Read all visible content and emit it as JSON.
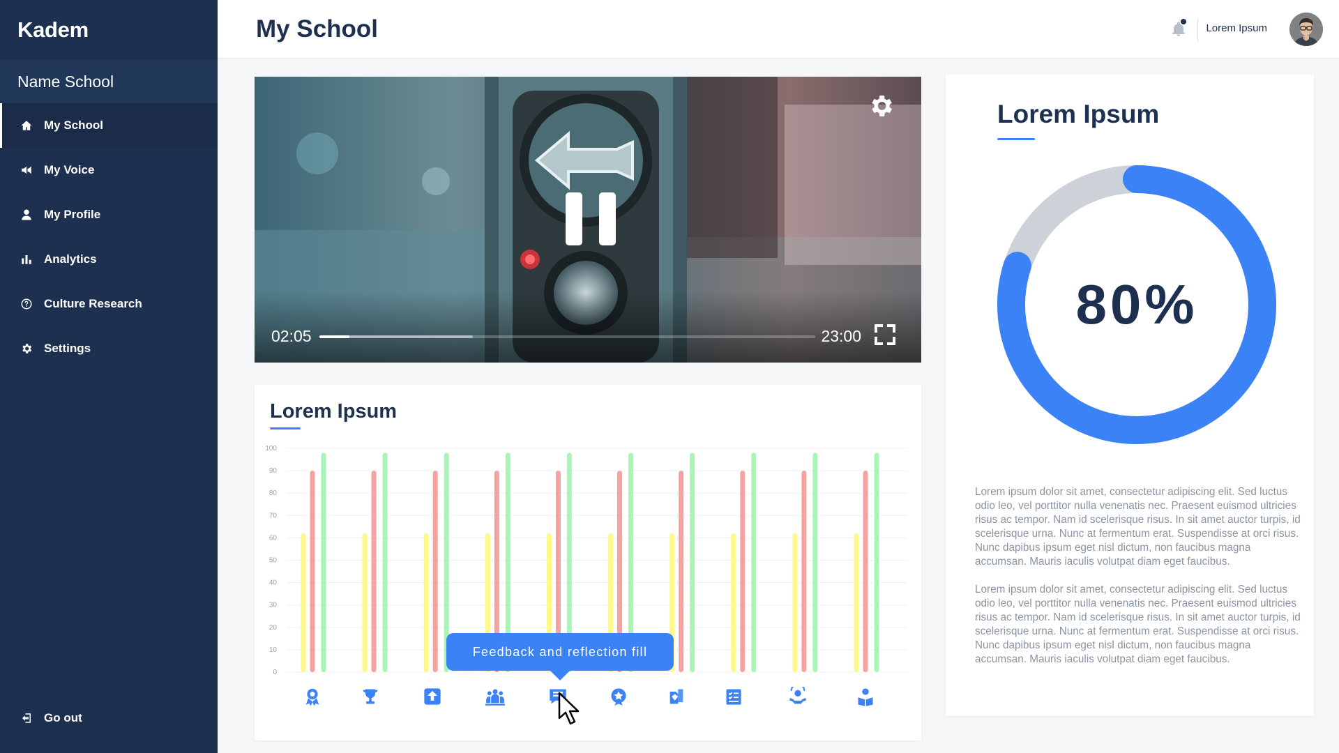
{
  "app": {
    "brand": "Kadem",
    "school_name": "Name School"
  },
  "sidebar": {
    "items": [
      {
        "label": "My School",
        "icon": "home-icon",
        "active": true
      },
      {
        "label": "My Voice",
        "icon": "megaphone-icon",
        "active": false
      },
      {
        "label": "My Profile",
        "icon": "user-icon",
        "active": false
      },
      {
        "label": "Analytics",
        "icon": "bar-chart-icon",
        "active": false
      },
      {
        "label": "Culture Research",
        "icon": "help-circle-icon",
        "active": false
      },
      {
        "label": "Settings",
        "icon": "gear-icon",
        "active": false
      }
    ],
    "logout_label": "Go out"
  },
  "header": {
    "title": "My School",
    "user_name": "Lorem Ipsum",
    "notification_unread": true
  },
  "video": {
    "current_time": "02:05",
    "total_time": "23:00",
    "progress_fraction": 0.06,
    "buffered_fraction": 0.31,
    "state": "playing"
  },
  "chart_card": {
    "title": "Lorem Ipsum",
    "tooltip": "Feedback and reflection fill",
    "hovered_category": 4
  },
  "chart_data": {
    "type": "bar",
    "title": "Lorem Ipsum",
    "categories": [
      "medal-icon",
      "trophy-icon",
      "upload-icon",
      "team-icon",
      "feedback-icon",
      "star-badge-icon",
      "handshake-icon",
      "checklist-icon",
      "support-icon",
      "reading-icon"
    ],
    "yticks": [
      0,
      10,
      20,
      30,
      40,
      50,
      60,
      70,
      80,
      90,
      100
    ],
    "ylim": [
      0,
      100
    ],
    "grid": true,
    "series": [
      {
        "color": "#fdf88a",
        "values": [
          62,
          62,
          62,
          62,
          62,
          62,
          62,
          62,
          62,
          62
        ]
      },
      {
        "color": "#f7a1a1",
        "values": [
          90,
          90,
          90,
          90,
          90,
          90,
          90,
          90,
          90,
          90
        ]
      },
      {
        "color": "#a8f5b6",
        "values": [
          98,
          98,
          98,
          98,
          98,
          98,
          98,
          98,
          98,
          98
        ]
      }
    ]
  },
  "summary_card": {
    "title": "Lorem Ipsum",
    "percent_label": "80%",
    "percent_value": 80,
    "colors": {
      "accent": "#3b82f6",
      "track": "#cdd1d8"
    },
    "paragraphs": [
      "Lorem ipsum dolor sit amet, consectetur adipiscing elit. Sed luctus odio leo, vel porttitor nulla venenatis nec. Praesent euismod ultricies risus ac tempor. Nam id scelerisque risus. In sit amet auctor turpis, id scelerisque urna. Nunc at fermentum erat. Suspendisse at orci risus. Nunc dapibus ipsum eget nisl dictum, non faucibus magna accumsan. Mauris iaculis volutpat diam eget faucibus.",
      "Lorem ipsum dolor sit amet, consectetur adipiscing elit. Sed luctus odio leo, vel porttitor nulla venenatis nec. Praesent euismod ultricies risus ac tempor. Nam id scelerisque risus. In sit amet auctor turpis, id scelerisque urna. Nunc at fermentum erat. Suspendisse at orci risus. Nunc dapibus ipsum eget nisl dictum, non faucibus magna accumsan. Mauris iaculis volutpat diam eget faucibus."
    ]
  }
}
